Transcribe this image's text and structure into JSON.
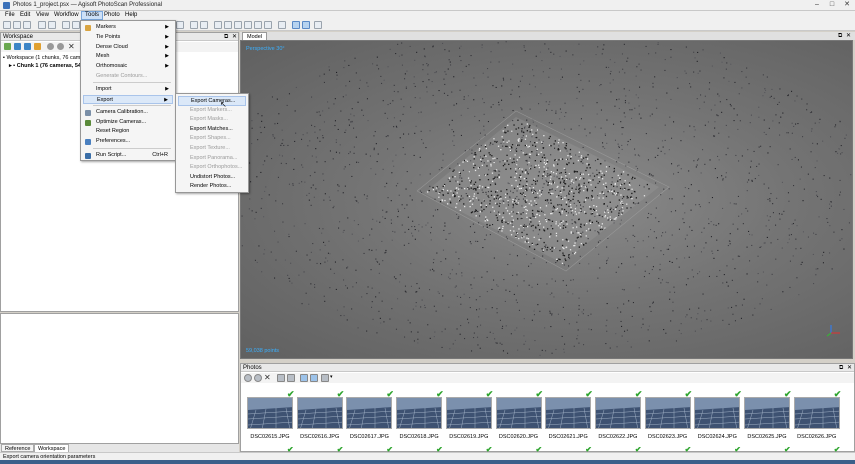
{
  "window": {
    "title": "Photos 1_project.psx — Agisoft PhotoScan Professional",
    "controls": [
      "–",
      "□",
      "✕"
    ]
  },
  "menubar": [
    "File",
    "Edit",
    "View",
    "Workflow",
    "Tools",
    "Photo",
    "Help"
  ],
  "tools_menu": {
    "items": [
      {
        "label": "Markers",
        "submenu": true,
        "disabled": false
      },
      {
        "label": "Tie Points",
        "submenu": true,
        "disabled": false
      },
      {
        "label": "Dense Cloud",
        "submenu": true,
        "disabled": false
      },
      {
        "label": "Mesh",
        "submenu": true,
        "disabled": false
      },
      {
        "label": "Orthomosaic",
        "submenu": true,
        "disabled": false
      },
      {
        "label": "Generate Contours...",
        "submenu": false,
        "disabled": true
      },
      {
        "label": "Import",
        "submenu": true,
        "disabled": false
      },
      {
        "label": "Export",
        "submenu": true,
        "disabled": false
      },
      {
        "label": "Camera Calibration...",
        "submenu": false,
        "disabled": false
      },
      {
        "label": "Optimize Cameras...",
        "submenu": false,
        "disabled": false
      },
      {
        "label": "Reset Region",
        "submenu": false,
        "disabled": false
      },
      {
        "label": "Preferences...",
        "submenu": false,
        "disabled": false
      },
      {
        "label": "Run Script...",
        "shortcut": "Ctrl+R",
        "disabled": false
      }
    ]
  },
  "export_menu": {
    "items": [
      {
        "label": "Export Cameras...",
        "disabled": false,
        "highlighted": true
      },
      {
        "label": "Export Markers...",
        "disabled": true
      },
      {
        "label": "Export Masks...",
        "disabled": true
      },
      {
        "label": "Export Matches...",
        "disabled": false
      },
      {
        "label": "Export Shapes...",
        "disabled": true
      },
      {
        "label": "Export Texture...",
        "disabled": true
      },
      {
        "label": "Export Panorama...",
        "disabled": true
      },
      {
        "label": "Export Orthophotos...",
        "disabled": true
      },
      {
        "label": "Undistort Photos...",
        "disabled": false
      },
      {
        "label": "Render Photos...",
        "disabled": false
      }
    ]
  },
  "workspace": {
    "title": "Workspace",
    "tree": [
      {
        "label": "Workspace (1 chunks, 76 cameras)"
      },
      {
        "label": "Chunk 1 (76 cameras, 54...",
        "bold": true
      }
    ]
  },
  "bottom_tabs": [
    "Reference",
    "Workspace"
  ],
  "model": {
    "tab": "Model",
    "perspective": "Perspective 30°",
    "points": "59,038 points"
  },
  "photos": {
    "title": "Photos",
    "items": [
      "DSC02615.JPG",
      "DSC02616.JPG",
      "DSC02617.JPG",
      "DSC02618.JPG",
      "DSC02619.JPG",
      "DSC02620.JPG",
      "DSC02621.JPG",
      "DSC02622.JPG",
      "DSC02623.JPG",
      "DSC02624.JPG",
      "DSC02625.JPG",
      "DSC02626.JPG"
    ]
  },
  "status": "Export camera orientation parameters",
  "colors": {
    "accent": "#3ab0ff",
    "check": "#2fa52f",
    "highlight": "#dbe8f8"
  }
}
